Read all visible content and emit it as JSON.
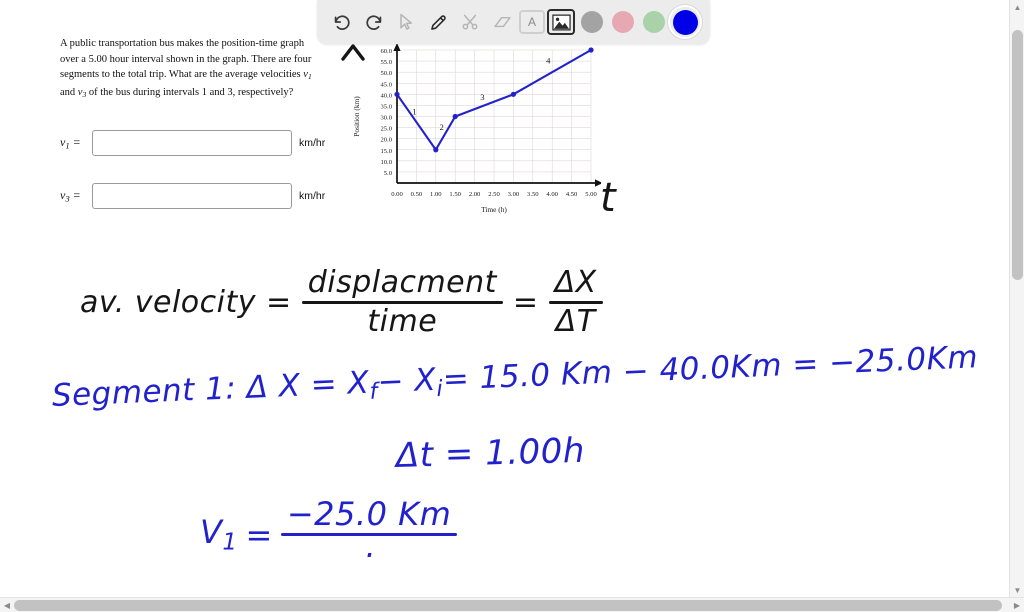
{
  "toolbar": {
    "tools": [
      {
        "name": "undo-icon",
        "label": "Undo",
        "state": "enabled"
      },
      {
        "name": "redo-icon",
        "label": "Redo",
        "state": "enabled"
      },
      {
        "name": "cursor-icon",
        "label": "Select",
        "state": "disabled"
      },
      {
        "name": "pencil-icon",
        "label": "Pen",
        "state": "enabled"
      },
      {
        "name": "scissors-icon",
        "label": "Cut",
        "state": "disabled"
      },
      {
        "name": "eraser-icon",
        "label": "Eraser",
        "state": "disabled"
      },
      {
        "name": "text-icon",
        "label": "A",
        "state": "disabled"
      },
      {
        "name": "image-icon",
        "label": "Image",
        "state": "active"
      }
    ],
    "colors": [
      {
        "name": "swatch-gray",
        "hex": "#a3a3a3",
        "selected": false
      },
      {
        "name": "swatch-pink",
        "hex": "#e6a8b2",
        "selected": false
      },
      {
        "name": "swatch-green",
        "hex": "#a9d2a9",
        "selected": false
      },
      {
        "name": "swatch-blue",
        "hex": "#0000e6",
        "selected": true
      }
    ]
  },
  "problem": {
    "line1": "A public transportation bus makes the position-time graph",
    "line2": "over a 5.00 hour interval shown in the graph. There are four",
    "line3_a": "segments to the total trip. What are the average velocities ",
    "line3_v": "v",
    "line3_sub": "1",
    "line4_a": "and ",
    "line4_v": "v",
    "line4_sub": "3",
    "line4_b": " of the bus during intervals 1 and 3, respectively?"
  },
  "answers": [
    {
      "id": "v1",
      "label_var": "v",
      "label_sub": "1",
      "label_eq": " =",
      "value": "",
      "placeholder": "",
      "unit": "km/hr"
    },
    {
      "id": "v3",
      "label_var": "v",
      "label_sub": "3",
      "label_eq": " =",
      "value": "",
      "placeholder": "",
      "unit": "km/hr"
    }
  ],
  "chart_data": {
    "type": "line",
    "title": "",
    "xlabel": "Time (h)",
    "ylabel": "Position (km)",
    "xlim": [
      0.0,
      5.0
    ],
    "ylim": [
      0.0,
      60.0
    ],
    "grid": true,
    "legend": "none",
    "line_color": "#2222cc",
    "x_ticks": [
      "0.00",
      "0.50",
      "1.00",
      "1.50",
      "2.00",
      "2.50",
      "3.00",
      "3.50",
      "4.00",
      "4.50",
      "5.00"
    ],
    "y_ticks": [
      "5.0",
      "10.0",
      "15.0",
      "20.0",
      "25.0",
      "30.0",
      "35.0",
      "40.0",
      "45.0",
      "50.0",
      "55.0",
      "60.0"
    ],
    "points": [
      {
        "x": 0.0,
        "y": 40.0
      },
      {
        "x": 1.0,
        "y": 15.0
      },
      {
        "x": 1.5,
        "y": 30.0
      },
      {
        "x": 3.0,
        "y": 40.0
      },
      {
        "x": 5.0,
        "y": 60.0
      }
    ],
    "annotations": [
      {
        "text": "1",
        "x": 0.45,
        "y": 31.0
      },
      {
        "text": "2",
        "x": 1.15,
        "y": 24.0
      },
      {
        "text": "3",
        "x": 2.2,
        "y": 37.5
      },
      {
        "text": "4",
        "x": 3.9,
        "y": 54.0
      }
    ]
  },
  "handwriting": {
    "caret_mark": "^",
    "t_mark": "t",
    "line1_lhs": "av. velocity =",
    "line1_frac_num": "displacment",
    "line1_frac_den": "time",
    "line1_eq": "=",
    "line1_frac2_num": "ΔX",
    "line1_frac2_den": "ΔT",
    "line2": "Segment 1:  Δ X = X",
    "line2_sub_f": "f",
    "line2_minus": "− X",
    "line2_sub_i": "i",
    "line2_rest": "= 15.0 Km − 40.0Km = −25.0Km",
    "line3": "Δt = 1.00h",
    "line4_lhs": "V",
    "line4_sub": "1",
    "line4_eq": "=",
    "line4_frac_num": "−25.0 Km",
    "line4_frac_den": "·"
  },
  "scrollbars": {
    "vertical_arrow_up": "▲",
    "vertical_arrow_down": "▼",
    "horizontal_arrow_left": "◀",
    "horizontal_arrow_right": "▶"
  }
}
